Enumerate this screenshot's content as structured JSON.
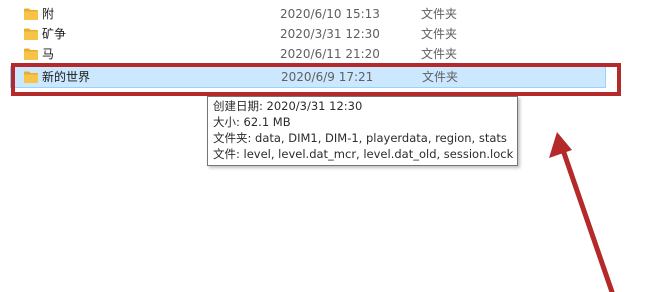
{
  "files": [
    {
      "name": "附",
      "modified": "2020/6/10 15:13",
      "type": "文件夹"
    },
    {
      "name": "矿争",
      "modified": "2020/3/31 12:30",
      "type": "文件夹"
    },
    {
      "name": "马",
      "modified": "2020/6/11 21:20",
      "type": "文件夹"
    },
    {
      "name": "新的世界",
      "modified": "2020/6/9 17:21",
      "type": "文件夹"
    }
  ],
  "tooltip": {
    "created": "创建日期: 2020/3/31 12:30",
    "size": "大小: 62.1 MB",
    "folders": "文件夹: data, DIM1, DIM-1, playerdata, region, stats",
    "files": "文件: level, level.dat_mcr, level.dat_old, session.lock"
  },
  "colors": {
    "selection_bg": "#cce8ff",
    "selection_border": "#99d1ff",
    "highlight": "#b42a2a",
    "folder": "#f7c44a"
  },
  "icons": {
    "folder": "folder-icon"
  }
}
